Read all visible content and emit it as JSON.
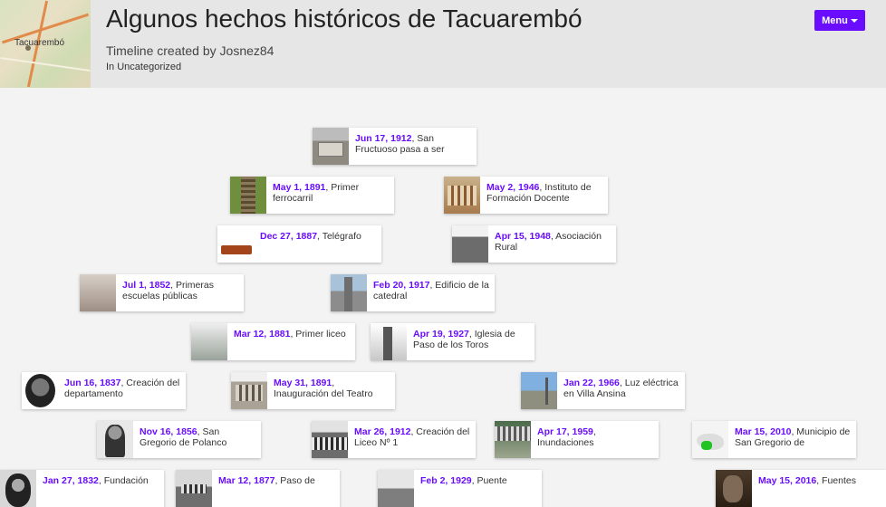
{
  "header": {
    "map_label": "Tacuarembó",
    "title": "Algunos hechos históricos de Tacuarembó",
    "subtitle": "Timeline created by Josnez84",
    "category": "In Uncategorized",
    "menu_label": "Menu"
  },
  "events": [
    {
      "date": "Jun 17, 1912",
      "text": ", San Fructuoso pasa a ser"
    },
    {
      "date": "May 1, 1891",
      "text": ", Primer ferrocarril"
    },
    {
      "date": "May 2, 1946",
      "text": ", Instituto de Formación Docente"
    },
    {
      "date": "Dec 27, 1887",
      "text": ", Telégrafo"
    },
    {
      "date": "Apr 15, 1948",
      "text": ", Asociación Rural"
    },
    {
      "date": "Jul 1, 1852",
      "text": ", Primeras escuelas públicas"
    },
    {
      "date": "Feb 20, 1917",
      "text": ", Edificio de la catedral"
    },
    {
      "date": "Mar 12, 1881",
      "text": ", Primer liceo"
    },
    {
      "date": "Apr 19, 1927",
      "text": ", Iglesia de Paso de los Toros"
    },
    {
      "date": "Jun 16, 1837",
      "text": ", Creación del departamento"
    },
    {
      "date": "May 31, 1891",
      "text": ", Inauguración del Teatro"
    },
    {
      "date": "Jan 22, 1966",
      "text": ", Luz eléctrica en Villa Ansina"
    },
    {
      "date": "Nov 16, 1856",
      "text": ", San Gregorio de Polanco"
    },
    {
      "date": "Mar 26, 1912",
      "text": ", Creación del Liceo Nº 1"
    },
    {
      "date": "Apr 17, 1959",
      "text": ", Inundaciones"
    },
    {
      "date": "Mar 15, 2010",
      "text": ", Municipio de San Gregorio de"
    },
    {
      "date": "Jan 27, 1832",
      "text": ", Fundación"
    },
    {
      "date": "Mar 12, 1877",
      "text": ", Paso de"
    },
    {
      "date": "Feb 2, 1929",
      "text": ", Puente"
    },
    {
      "date": "May 15, 2016",
      "text": ", Fuentes"
    }
  ]
}
